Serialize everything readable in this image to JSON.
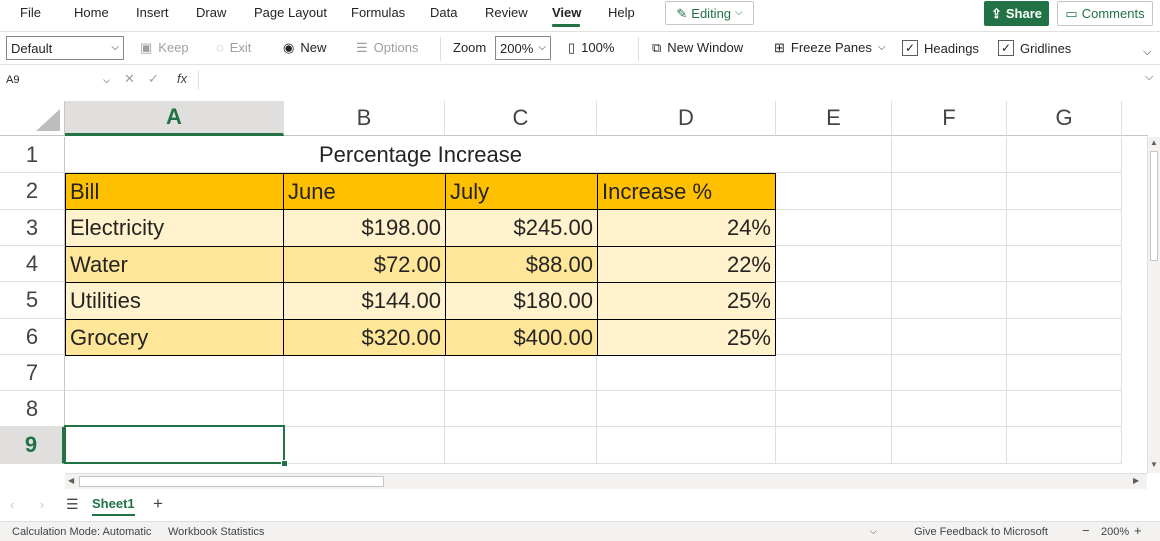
{
  "menu": {
    "items": [
      "File",
      "Home",
      "Insert",
      "Draw",
      "Page Layout",
      "Formulas",
      "Data",
      "Review",
      "View",
      "Help"
    ],
    "active": "View",
    "editing_label": "Editing",
    "share_label": "Share",
    "comments_label": "Comments"
  },
  "ribbon": {
    "view_select": "Default",
    "keep_label": "Keep",
    "exit_label": "Exit",
    "new_label": "New",
    "options_label": "Options",
    "zoom_label": "Zoom",
    "zoom_value": "200%",
    "hundred_label": "100%",
    "new_window_label": "New Window",
    "freeze_label": "Freeze Panes",
    "headings_label": "Headings",
    "headings_checked": true,
    "gridlines_label": "Gridlines",
    "gridlines_checked": true
  },
  "formula_bar": {
    "name_box": "A9",
    "fx": "fx",
    "value": ""
  },
  "grid": {
    "columns": [
      "A",
      "B",
      "C",
      "D",
      "E",
      "F",
      "G"
    ],
    "selected_column": "A",
    "rows": [
      "1",
      "2",
      "3",
      "4",
      "5",
      "6",
      "7",
      "8",
      "9"
    ],
    "selected_row": "9",
    "title": "Percentage Increase",
    "headers": [
      "Bill",
      "June",
      "July",
      "Increase %"
    ],
    "data": [
      [
        "Electricity",
        "$198.00",
        "$245.00",
        "24%"
      ],
      [
        "Water",
        "$72.00",
        "$88.00",
        "22%"
      ],
      [
        "Utilities",
        "$144.00",
        "$180.00",
        "25%"
      ],
      [
        "Grocery",
        "$320.00",
        "$400.00",
        "25%"
      ]
    ]
  },
  "colors": {
    "accent": "#217346",
    "header_fill": "#ffc000",
    "band_light": "#fff2cc",
    "band_dark": "#ffe699"
  },
  "sheets": {
    "tabs": [
      "Sheet1"
    ],
    "active": "Sheet1",
    "add_label": "+"
  },
  "status": {
    "calc_mode": "Calculation Mode: Automatic",
    "workbook_stats": "Workbook Statistics",
    "feedback": "Give Feedback to Microsoft",
    "zoom": "200%"
  }
}
